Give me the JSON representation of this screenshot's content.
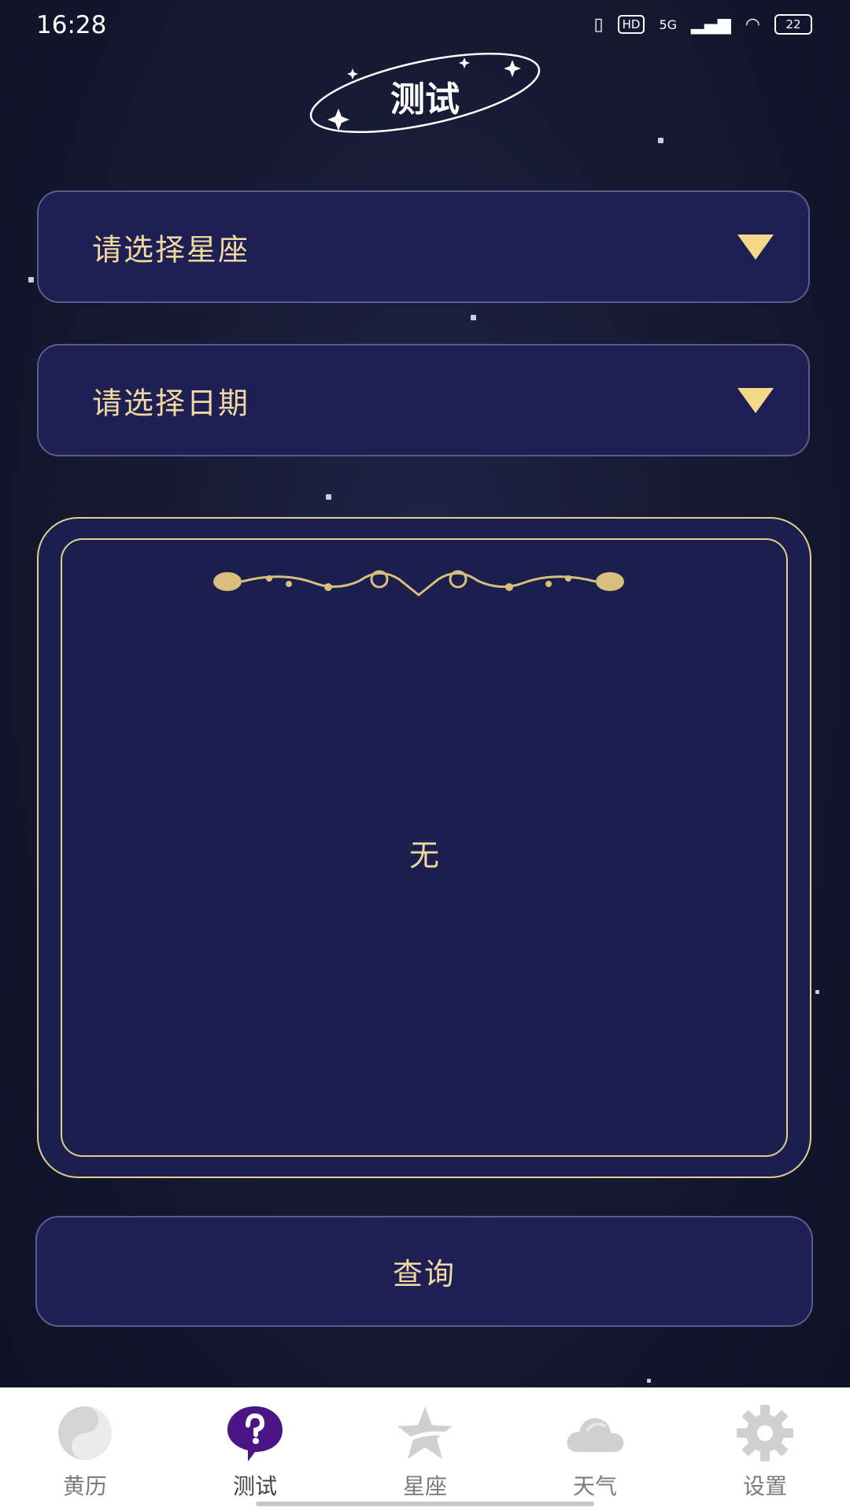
{
  "status_bar": {
    "time": "16:28",
    "hd": "HD",
    "network": "5G",
    "battery": "22"
  },
  "header": {
    "title": "测试"
  },
  "selectors": {
    "constellation_placeholder": "请选择星座",
    "date_placeholder": "请选择日期"
  },
  "result": {
    "text": "无"
  },
  "query_button": {
    "label": "查询"
  },
  "bottom_nav": {
    "items": [
      {
        "label": "黄历",
        "icon": "yin-yang-icon",
        "active": false
      },
      {
        "label": "测试",
        "icon": "question-bubble-icon",
        "active": true
      },
      {
        "label": "星座",
        "icon": "star-icon",
        "active": false
      },
      {
        "label": "天气",
        "icon": "cloud-icon",
        "active": false
      },
      {
        "label": "设置",
        "icon": "gear-icon",
        "active": false
      }
    ]
  },
  "colors": {
    "background": "#161a33",
    "panel": "#1e1f55",
    "gold": "#f1d89e",
    "active_nav": "#4b1585",
    "inactive_nav": "#c9c9c9"
  }
}
